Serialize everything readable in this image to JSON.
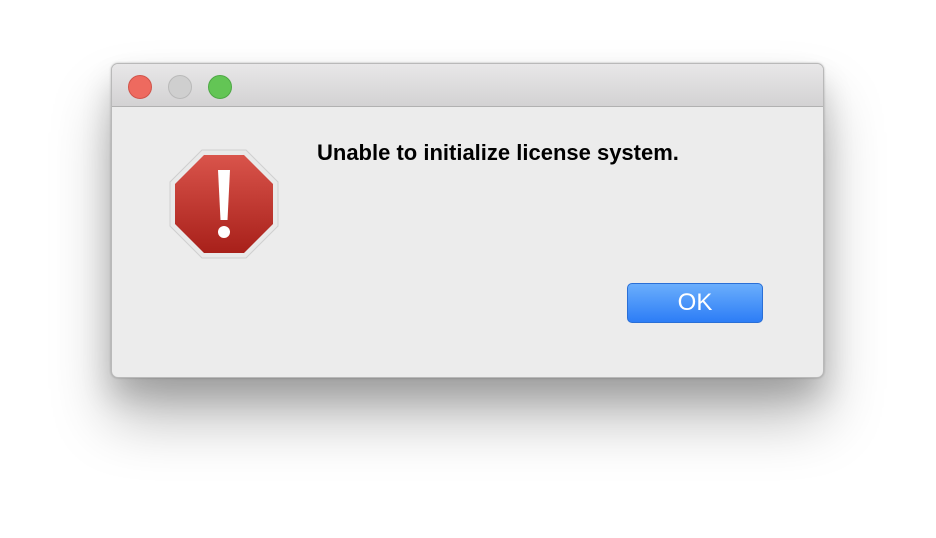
{
  "dialog": {
    "message": "Unable to initialize license system.",
    "ok_label": "OK",
    "icon": "stop-alert-icon"
  },
  "window_controls": [
    "close",
    "minimize",
    "zoom"
  ],
  "colors": {
    "accent_button": "#2d7df6",
    "alert_red": "#c0322a",
    "close": "#ee6a5f",
    "minimize_disabled": "#cfcfcf",
    "zoom": "#63c555"
  }
}
